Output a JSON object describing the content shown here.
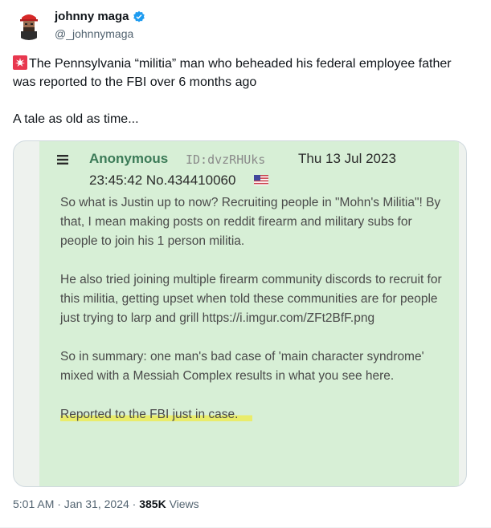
{
  "author": {
    "name": "johnny maga",
    "handle": "@_johnnymaga",
    "verified": true,
    "verified_badge_color": "#1d9bf0"
  },
  "tweet": {
    "line1": "The Pennsylvania “militia” man who beheaded his federal employee father was reported to the FBI over 6 months ago",
    "line2": "A tale as old as time...",
    "emoji": "police-siren-icon"
  },
  "embedded_post": {
    "poster": "Anonymous",
    "id": "ID:dvzRHUks",
    "date": "Thu 13 Jul 2023",
    "time_no": "23:45:42 No.434410060",
    "flag": "us-flag-icon",
    "paragraphs": [
      "So what is Justin up to now? Recruiting people in \"Mohn's Militia\"! By that, I mean making posts on reddit firearm and military subs for people to join his 1 person militia.",
      "He also tried joining multiple firearm community discords to recruit for this militia, getting upset when told these communities are for people just trying to larp and grill https://i.imgur.com/ZFt2BfF.png",
      "So in summary: one man's bad case of 'main character syndrome' mixed with a Messiah Complex results in what you see here."
    ],
    "highlighted": "Reported to the FBI just in case.",
    "colors": {
      "background": "#d7efd6",
      "name": "#3b7a57",
      "highlight": "#ecec58"
    }
  },
  "meta": {
    "time": "5:01 AM · Jan 31, 2024 · ",
    "views_count": "385K",
    "views_label": " Views"
  }
}
